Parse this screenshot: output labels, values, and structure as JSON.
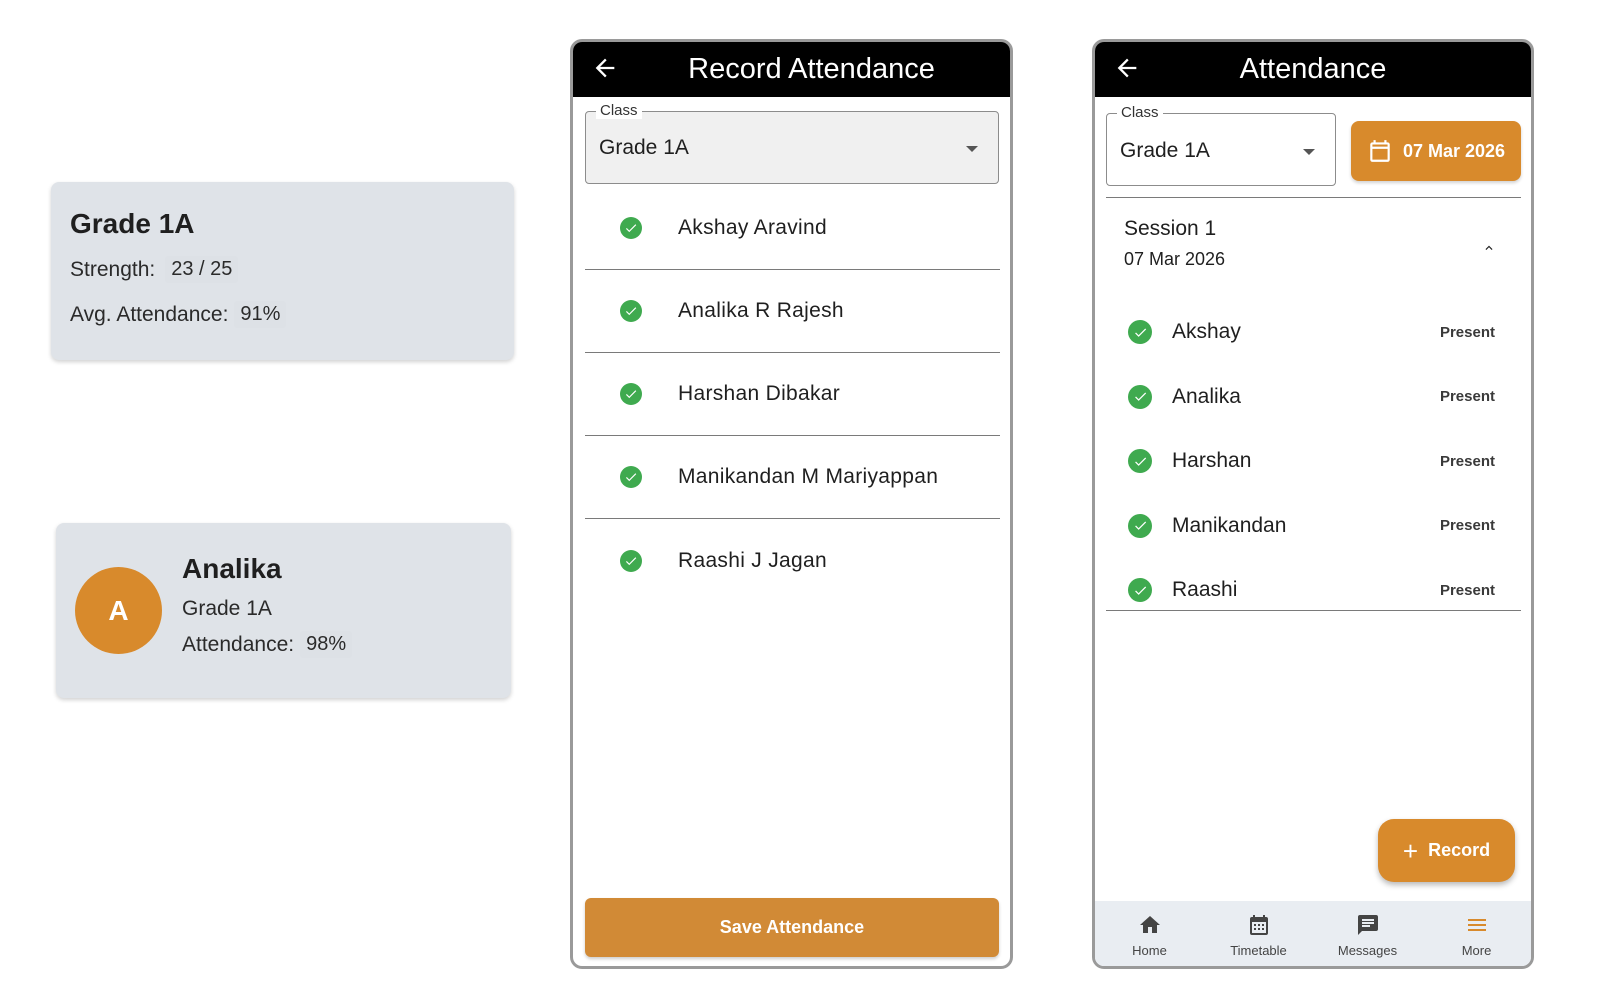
{
  "class_card": {
    "title": "Grade 1A",
    "strength_label": "Strength:",
    "strength_value": "23 / 25",
    "avg_label": "Avg. Attendance:",
    "avg_value": "91%"
  },
  "student_card": {
    "avatar_initial": "A",
    "name": "Analika",
    "grade": "Grade 1A",
    "attendance_label": "Attendance:",
    "attendance_value": "98%"
  },
  "record_screen": {
    "title": "Record Attendance",
    "class_field": {
      "label": "Class",
      "value": "Grade 1A"
    },
    "students": [
      {
        "name": "Akshay  Aravind"
      },
      {
        "name": "Analika R Rajesh"
      },
      {
        "name": "Harshan  Dibakar"
      },
      {
        "name": "Manikandan M Mariyappan"
      },
      {
        "name": "Raashi J Jagan"
      }
    ],
    "save_button": "Save Attendance"
  },
  "attendance_screen": {
    "title": "Attendance",
    "class_field": {
      "label": "Class",
      "value": "Grade 1A"
    },
    "date_button": "07 Mar 2026",
    "session": {
      "title": "Session 1",
      "date": "07 Mar 2026"
    },
    "students": [
      {
        "name": "Akshay",
        "status": "Present"
      },
      {
        "name": "Analika",
        "status": "Present"
      },
      {
        "name": "Harshan",
        "status": "Present"
      },
      {
        "name": "Manikandan",
        "status": "Present"
      },
      {
        "name": "Raashi",
        "status": "Present"
      }
    ],
    "fab_label": "Record",
    "nav": [
      {
        "label": "Home",
        "icon": "home-icon"
      },
      {
        "label": "Timetable",
        "icon": "calendar-icon"
      },
      {
        "label": "Messages",
        "icon": "message-icon"
      },
      {
        "label": "More",
        "icon": "menu-icon"
      }
    ]
  },
  "colors": {
    "accent": "#d88a2c",
    "card_bg": "#dfe3e8",
    "check_green": "#3faa4f",
    "appbar": "#000000",
    "more_active": "#d88a2c"
  }
}
